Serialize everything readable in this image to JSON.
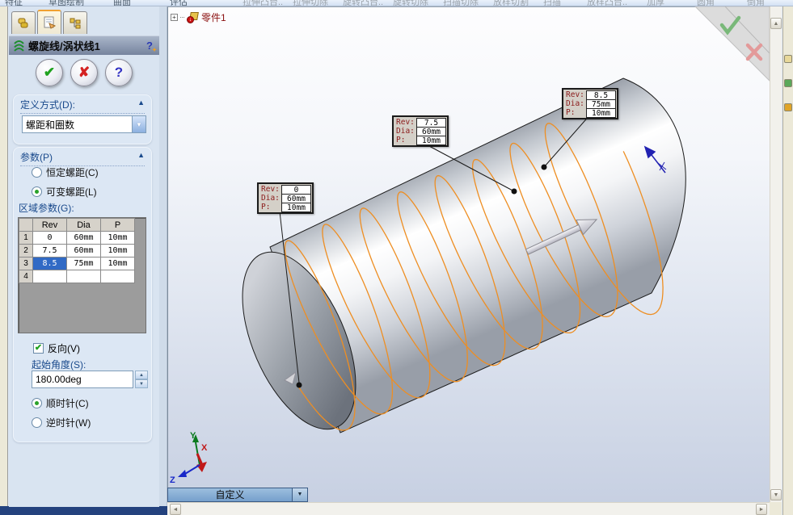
{
  "toolbar": {
    "menus": [
      "特征",
      "草图绘制",
      "曲面",
      "评估"
    ],
    "buttons": [
      "拉伸凸台..",
      "拉伸切除",
      "旋转凸台..",
      "旋转切除",
      "扫描切除",
      "放样切割",
      "扫描",
      "放样凸台..",
      "加厚",
      "圆角",
      "倒角"
    ]
  },
  "panel": {
    "title": "螺旋线/涡状线1",
    "definition": {
      "header": "定义方式(D):",
      "value": "螺距和圈数"
    },
    "params": {
      "header": "参数(P)",
      "constant_pitch": "恒定螺距(C)",
      "variable_pitch": "可变螺距(L)",
      "region_label": "区域参数(G):",
      "table": {
        "headers": [
          "",
          "Rev",
          "Dia",
          "P"
        ],
        "rows": [
          [
            "1",
            "0",
            "60mm",
            "10mm"
          ],
          [
            "2",
            "7.5",
            "60mm",
            "10mm"
          ],
          [
            "3",
            "8.5",
            "75mm",
            "10mm"
          ],
          [
            "4",
            "",
            "",
            ""
          ]
        ],
        "selection": {
          "row": 2,
          "col": "Rev",
          "value": "8.5"
        }
      },
      "reverse": "反向(V)",
      "start_angle_label": "起始角度(S):",
      "start_angle": "180.00deg",
      "clockwise": "顺时针(C)",
      "counterclockwise": "逆时针(W)"
    }
  },
  "viewport": {
    "tree_root": "零件1",
    "callout_labels": {
      "rev": "Rev:",
      "dia": "Dia:",
      "p": "P:"
    },
    "callouts": [
      {
        "rev": "0",
        "dia": "60mm",
        "p": "10mm"
      },
      {
        "rev": "7.5",
        "dia": "60mm",
        "p": "10mm"
      },
      {
        "rev": "8.5",
        "dia": "75mm",
        "p": "10mm"
      }
    ],
    "view_selector": "自定义",
    "triad": {
      "x": "X",
      "y": "Y",
      "z": "Z"
    }
  },
  "icons": {
    "check": "✔",
    "cross": "✘",
    "help": "?",
    "star": "✦",
    "chevron_down": "▼",
    "spin_up": "▲",
    "spin_down": "▼",
    "scroll_up": "▲",
    "scroll_down": "▼",
    "scroll_left": "◄",
    "scroll_right": "►",
    "expand": "+",
    "rebuild": "↓",
    "collapse_up": "▲"
  },
  "colors": {
    "helix": "#EE8E22",
    "selection": "#316AC5",
    "panel_bg": "#D9E4F1",
    "callout_label": "#8B1A1A",
    "tree_text": "#8B1111",
    "view_selector_bg": "#86ACD4"
  }
}
